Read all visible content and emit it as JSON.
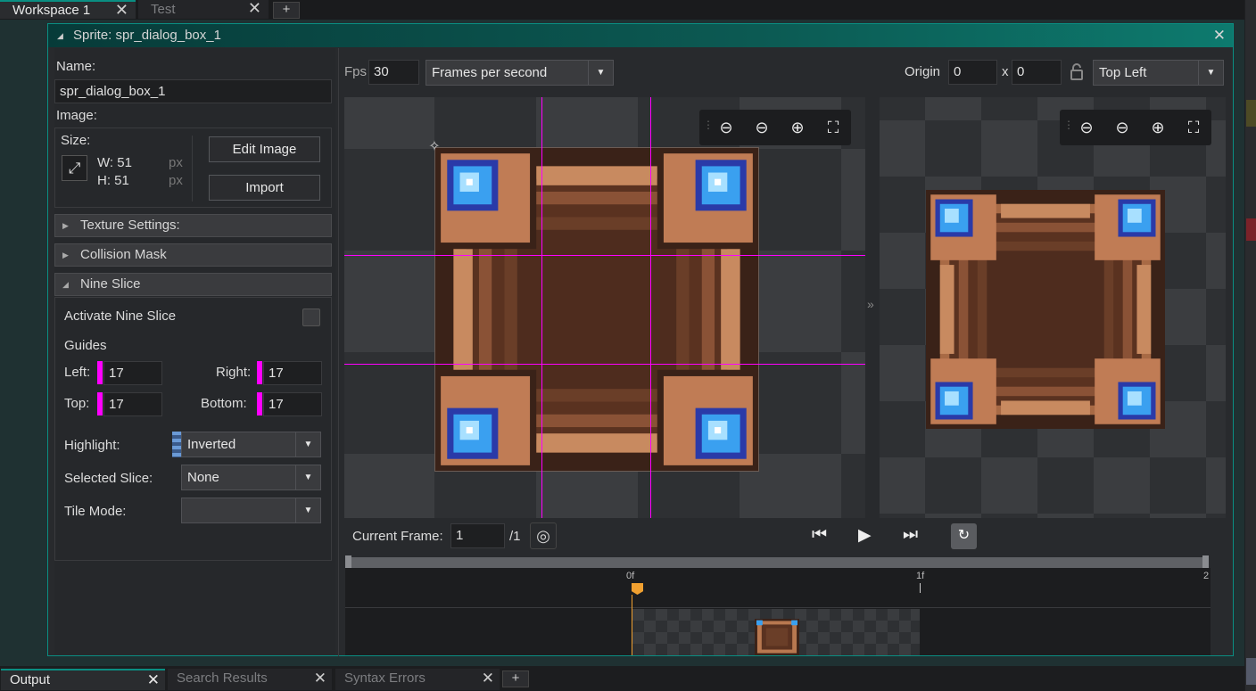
{
  "workspace_tabs": [
    {
      "label": "Workspace 1",
      "active": true
    },
    {
      "label": "Test",
      "active": false
    }
  ],
  "add_tab": "+",
  "window": {
    "title": "Sprite: spr_dialog_box_1",
    "close": "✕"
  },
  "left": {
    "name_label": "Name:",
    "name_value": "spr_dialog_box_1",
    "image_label": "Image:",
    "size_label": "Size:",
    "width": "W: 51",
    "height": "H: 51",
    "px": "px",
    "edit_image": "Edit Image",
    "import": "Import",
    "texture_settings": "Texture Settings:",
    "collision_mask": "Collision Mask",
    "nine_slice": "Nine Slice",
    "activate_nine_slice": "Activate Nine Slice",
    "guides": "Guides",
    "left_label": "Left:",
    "left_value": "17",
    "right_label": "Right:",
    "right_value": "17",
    "top_label": "Top:",
    "top_value": "17",
    "bottom_label": "Bottom:",
    "bottom_value": "17",
    "highlight_label": "Highlight:",
    "highlight_value": "Inverted",
    "selected_slice_label": "Selected Slice:",
    "selected_slice_value": "None",
    "tile_mode_label": "Tile Mode:",
    "tile_mode_value": ""
  },
  "toolbar": {
    "fps_label": "Fps",
    "fps_value": "30",
    "fps_mode": "Frames per second",
    "origin_label": "Origin",
    "origin_x": "0",
    "x_sep": "x",
    "origin_y": "0",
    "origin_mode": "Top Left"
  },
  "playback": {
    "current_frame_label": "Current Frame:",
    "current_frame_value": "1",
    "total_frames": "/1"
  },
  "timeline": {
    "ticks": [
      "0f",
      "1f",
      "2"
    ]
  },
  "expander": "»",
  "bottom_tabs": [
    {
      "label": "Output",
      "active": true
    },
    {
      "label": "Search Results",
      "active": false
    },
    {
      "label": "Syntax Errors",
      "active": false
    }
  ],
  "colors": {
    "accent": "#0a8e82",
    "guide": "#ff00ff",
    "frame_wood": "#b87850",
    "frame_dark": "#4a2a1c",
    "gem": "#2a8ee8"
  }
}
